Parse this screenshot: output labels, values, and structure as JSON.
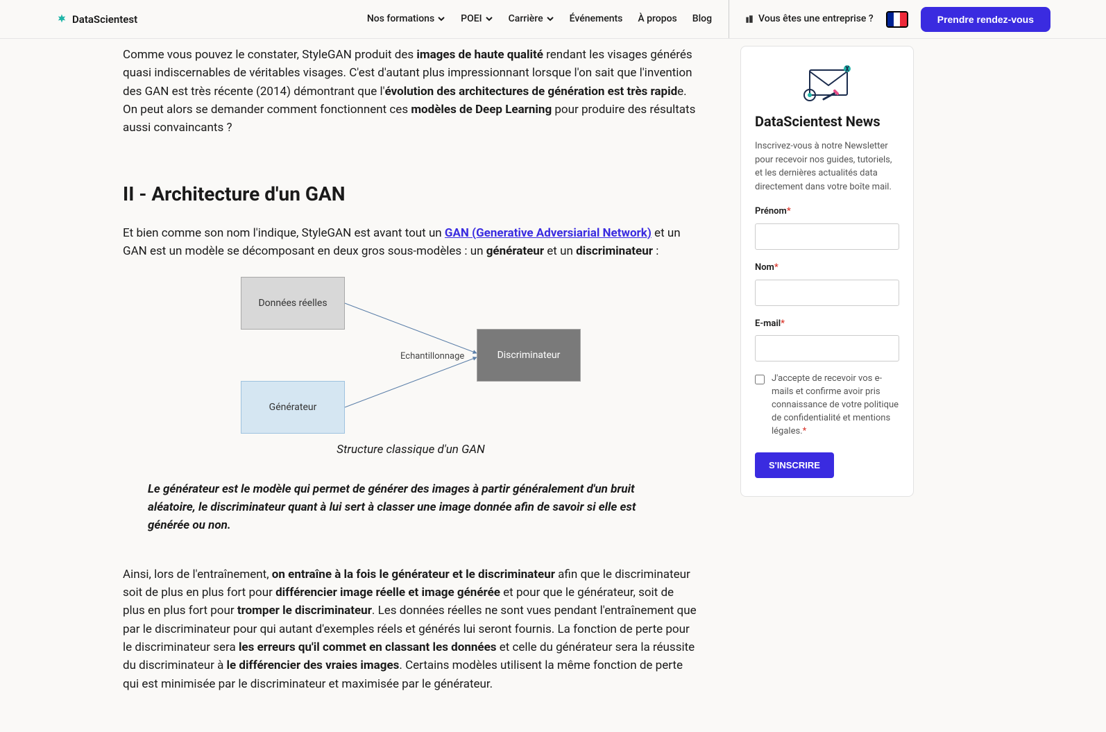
{
  "header": {
    "brand": "DataScientest",
    "nav": [
      {
        "label": "Nos formations",
        "dropdown": true
      },
      {
        "label": "POEI",
        "dropdown": true
      },
      {
        "label": "Carrière",
        "dropdown": true
      },
      {
        "label": "Événements",
        "dropdown": false
      },
      {
        "label": "À propos",
        "dropdown": false
      },
      {
        "label": "Blog",
        "dropdown": false
      }
    ],
    "enterprise": "Vous êtes une entreprise ?",
    "cta": "Prendre rendez-vous"
  },
  "article": {
    "p1": {
      "pre": "Comme vous pouvez le constater, StyleGAN produit des ",
      "b1": "images de haute qualité",
      "mid1": " rendant les visages générés quasi indiscernables de véritables visages. C'est d'autant plus impressionnant lorsque l'on sait que l'invention des GAN est très récente (2014) démontrant que l'",
      "b2": "évolution des architectures de génération est très rapid",
      "mid2": "e. On peut alors se demander comment fonctionnent ces ",
      "b3": "modèles de Deep Learning",
      "end": " pour produire des résultats aussi convaincants ?"
    },
    "h2": "II - Architecture d'un GAN",
    "p2": {
      "pre": "Et bien comme son nom l'indique, StyleGAN est avant tout un ",
      "link": "GAN (Generative Adversiarial Network)",
      "mid1": " et un GAN est un modèle se décomposant en deux gros sous-modèles : un ",
      "b1": "générateur",
      "mid2": " et un ",
      "b2": "discriminateur",
      "end": " :"
    },
    "diagram": {
      "data_box": "Données réelles",
      "gen_box": "Générateur",
      "disc_box": "Discriminateur",
      "label": "Echantillonnage",
      "caption": "Structure classique d'un GAN"
    },
    "quote": "Le générateur est le modèle qui permet de générer des images à partir généralement d'un bruit aléatoire, le discriminateur quant à lui sert à classer une image donnée afin de savoir si elle est générée ou non.",
    "p3": {
      "pre": "Ainsi, lors de l'entraînement, ",
      "b1": "on entraîne à la fois le générateur et le discriminateur",
      "mid1": " afin que le discriminateur soit de plus en plus fort pour ",
      "b2": "différencier image réelle et image générée",
      "mid2": " et pour que le générateur, soit de plus en plus fort pour ",
      "b3": "tromper le discriminateur",
      "mid3": ". Les données réelles ne sont vues pendant l'entraînement que par le discriminateur pour qui autant d'exemples réels et générés lui seront fournis. La fonction de perte pour le discriminateur sera ",
      "b4": "les erreurs qu'il commet en classant les données",
      "mid4": " et celle du générateur sera la réussite du discriminateur à ",
      "b5": "le différencier des vraies images",
      "end": ". Certains modèles utilisent la même fonction de perte qui est minimisée par le discriminateur et maximisée par le générateur."
    }
  },
  "sidebar": {
    "title": "DataScientest News",
    "desc": "Inscrivez-vous à notre Newsletter pour recevoir nos guides, tutoriels, et les dernières actualités data directement dans votre boîte mail.",
    "firstname_label": "Prénom",
    "lastname_label": "Nom",
    "email_label": "E-mail",
    "consent": "J'accepte de recevoir vos e-mails et confirme avoir pris connaissance de votre politique de confidentialité et mentions légales.",
    "submit": "S'INSCRIRE",
    "asterisk": "*"
  }
}
